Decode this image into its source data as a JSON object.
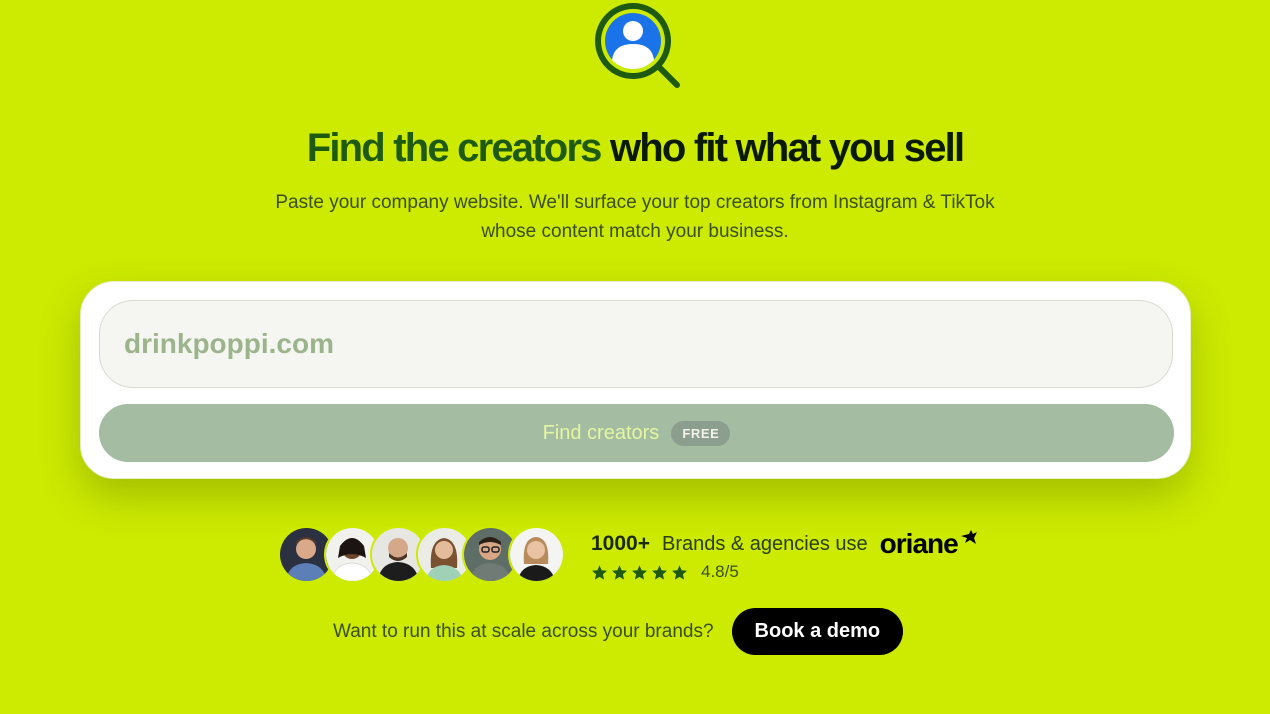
{
  "colors": {
    "background": "#cdeb00",
    "accent_dark_green": "#1f5a12",
    "button_disabled": "#a3bca2",
    "logo_blue": "#1a73e8",
    "demo_button": "#000000"
  },
  "logo": {
    "icon": "user-search-icon"
  },
  "hero": {
    "title_accent": "Find the creators",
    "title_rest": " who fit what you sell",
    "subtitle_line1": "Paste your company website. We'll surface your top creators from Instagram & TikTok",
    "subtitle_line2": "whose content match your business."
  },
  "search": {
    "placeholder": "drinkpoppi.com",
    "value": "",
    "button_label": "Find creators",
    "badge": "FREE"
  },
  "social_proof": {
    "avatar_count": 6,
    "count": "1000+",
    "text": "Brands & agencies use",
    "brand": "oriane",
    "brand_icon": "bird-icon",
    "stars": 5,
    "star_icon": "star-icon",
    "rating": "4.8/5"
  },
  "cta": {
    "text": "Want to run this at scale across your brands?",
    "button_label": "Book a demo"
  }
}
